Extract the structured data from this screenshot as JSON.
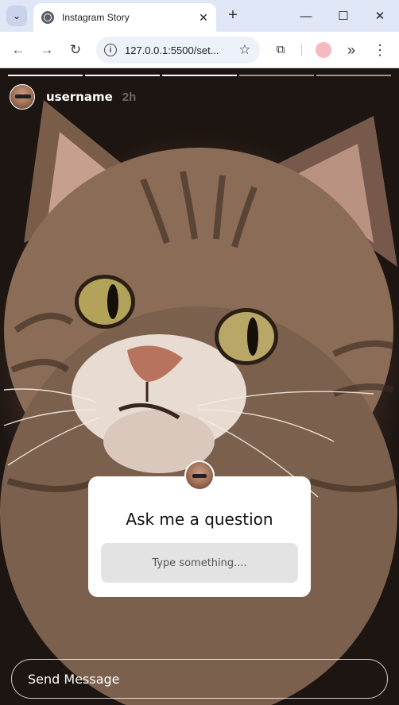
{
  "browser": {
    "tab_title": "Instagram Story",
    "url": "127.0.0.1:5500/set...",
    "tab_menu_glyph": "⌄",
    "close_glyph": "✕",
    "newtab_glyph": "+",
    "minimize_glyph": "—",
    "maximize_glyph": "☐",
    "window_close_glyph": "✕",
    "back_glyph": "←",
    "forward_glyph": "→",
    "reload_glyph": "↻",
    "star_glyph": "☆",
    "extensions_glyph": "⧉",
    "more_tools_glyph": "»",
    "menu_glyph": "⋮",
    "info_glyph": "i"
  },
  "story": {
    "progress": [
      1,
      1,
      1,
      0,
      0
    ],
    "username": "username",
    "time": "2h",
    "question": {
      "title": "Ask me a question",
      "placeholder": "Type something...."
    },
    "send_placeholder": "Send Message"
  },
  "colors": {
    "chrome_bg": "#dfe6f5",
    "omnibox_bg": "#edf1fa",
    "profile": "#f6b9bf",
    "card_bg": "#ffffff",
    "input_bg": "#e3e3e3"
  }
}
